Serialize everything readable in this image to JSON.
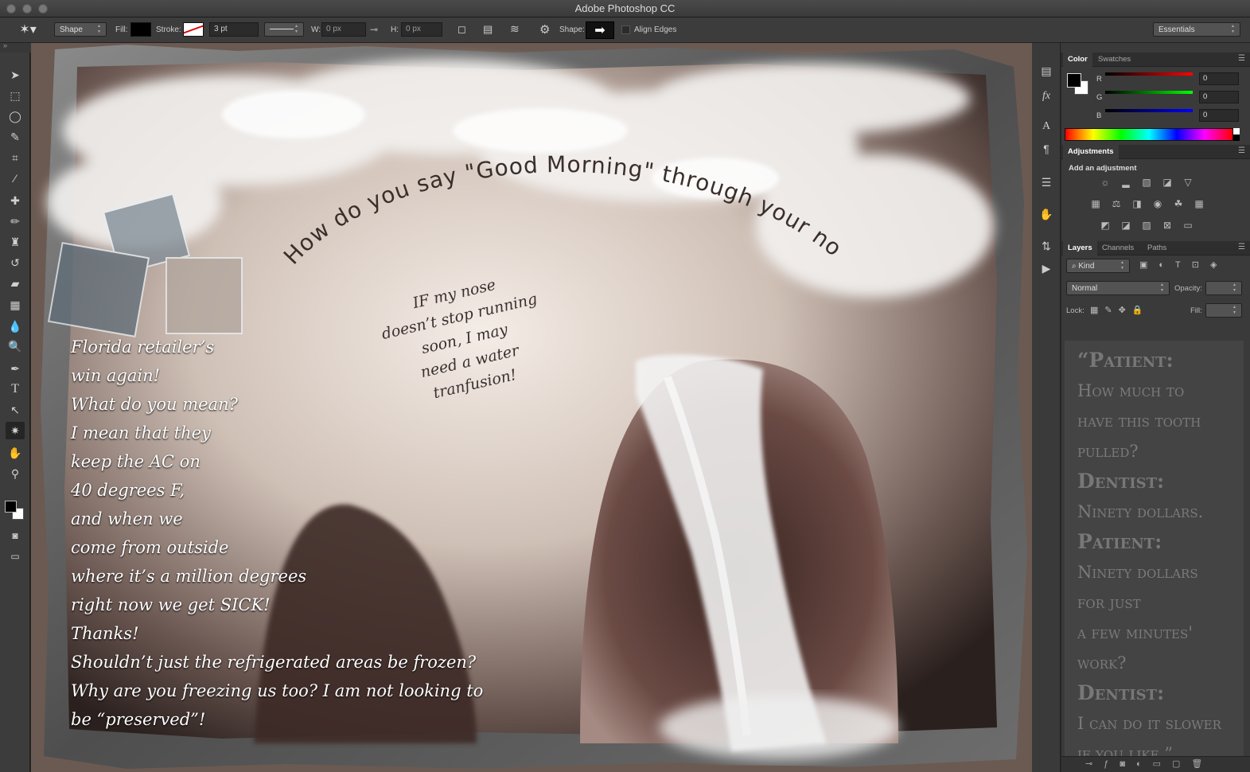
{
  "app": {
    "title": "Adobe Photoshop CC"
  },
  "options": {
    "mode": "Shape",
    "fill_label": "Fill:",
    "stroke_label": "Stroke:",
    "stroke_width": "3 pt",
    "w_label": "W:",
    "w_value": "0 px",
    "h_label": "H:",
    "h_value": "0 px",
    "shape_label": "Shape:",
    "align_edges": "Align Edges",
    "workspace": "Essentials"
  },
  "color_panel": {
    "tabs": [
      "Color",
      "Swatches"
    ],
    "r_label": "R",
    "g_label": "G",
    "b_label": "B",
    "r": "0",
    "g": "0",
    "b": "0"
  },
  "adjustments": {
    "tab": "Adjustments",
    "hint": "Add an adjustment"
  },
  "layers_panel": {
    "tabs": [
      "Layers",
      "Channels",
      "Paths"
    ],
    "kind": "Kind",
    "blend": "Normal",
    "opacity_label": "Opacity:",
    "lock_label": "Lock:",
    "fill_label": "Fill:"
  },
  "layer_preview_text": [
    {
      "text": "“Patient:",
      "big": true
    },
    {
      "text": "How much to",
      "big": false
    },
    {
      "text": "have this tooth",
      "big": false
    },
    {
      "text": "pulled?",
      "big": false
    },
    {
      "text": "Dentist:",
      "big": true
    },
    {
      "text": "Ninety dollars.",
      "big": false
    },
    {
      "text": "Patient:",
      "big": true
    },
    {
      "text": "Ninety dollars",
      "big": false
    },
    {
      "text": "for just",
      "big": false
    },
    {
      "text": "a few minutes'",
      "big": false
    },
    {
      "text": "work?",
      "big": false
    },
    {
      "text": "Dentist:",
      "big": true
    },
    {
      "text": "I can do it slower",
      "big": false
    },
    {
      "text": "if you like.”",
      "big": false
    }
  ],
  "artwork": {
    "arc_title": "How do you say \"Good Morning\" through your nose?",
    "center_note": [
      "IF my nose",
      "doesn’t stop running",
      "soon, I may",
      "need a water",
      "tranfusion!"
    ],
    "left_note": [
      "Florida retailer’s",
      "win again!",
      "What do you mean?",
      "I mean that they",
      "keep the AC on",
      "40 degrees F,",
      "and when we",
      "come from outside",
      "where it’s a million degrees",
      "right now we get SICK!",
      "Thanks!",
      "Shouldn’t just the refrigerated areas be frozen?",
      "Why are you freezing us too? I am not looking to",
      "be “preserved”!"
    ]
  },
  "colors": {
    "fg": "#000000",
    "bg": "#ffffff",
    "chrome": "#3c3c3c"
  },
  "tools": [
    "move-tool-icon",
    "marquee-tool-icon",
    "lasso-tool-icon",
    "quick-select-tool-icon",
    "crop-tool-icon",
    "eyedropper-tool-icon",
    "healing-brush-tool-icon",
    "brush-tool-icon",
    "clone-stamp-tool-icon",
    "history-brush-tool-icon",
    "eraser-tool-icon",
    "gradient-tool-icon",
    "blur-tool-icon",
    "dodge-tool-icon",
    "pen-tool-icon",
    "type-tool-icon",
    "path-select-tool-icon",
    "custom-shape-tool-icon",
    "hand-tool-icon",
    "zoom-tool-icon"
  ]
}
